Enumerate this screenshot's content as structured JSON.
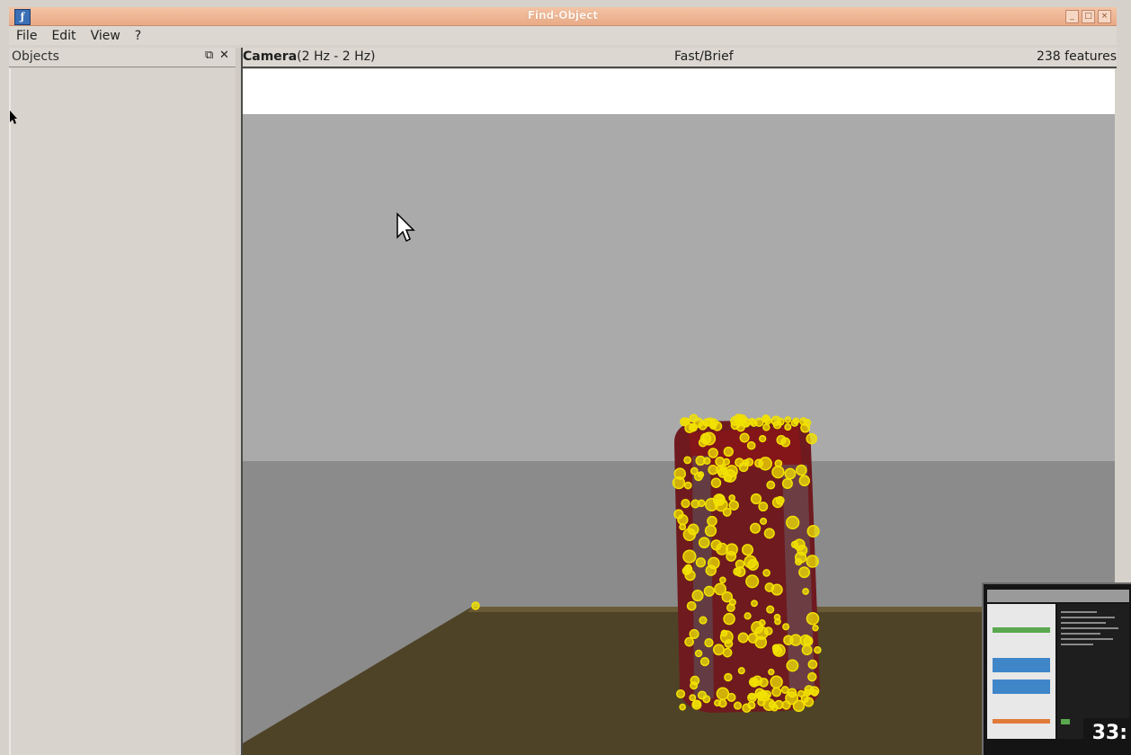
{
  "window": {
    "title": "Find-Object",
    "app_icon": "find-object-app-icon",
    "app_icon_glyph": "ƒ",
    "controls": [
      "minimize-icon",
      "maximize-icon",
      "close-icon"
    ]
  },
  "menu": {
    "items": [
      "File",
      "Edit",
      "View",
      "?"
    ]
  },
  "objects_dock": {
    "title": "Objects",
    "float_glyph": "⧉",
    "close_glyph": "✕"
  },
  "camera": {
    "name": "Camera",
    "rate": "(2 Hz - 2 Hz)",
    "mode": "Fast/Brief",
    "features": "238 features"
  },
  "thumbnail": {
    "timestamp": "33:"
  },
  "colors": {
    "feature": "#f2e100",
    "can": "#7a1a1e",
    "table": "#4e4226",
    "wall": "#a9a9a9",
    "floor": "#8c8c8c"
  }
}
